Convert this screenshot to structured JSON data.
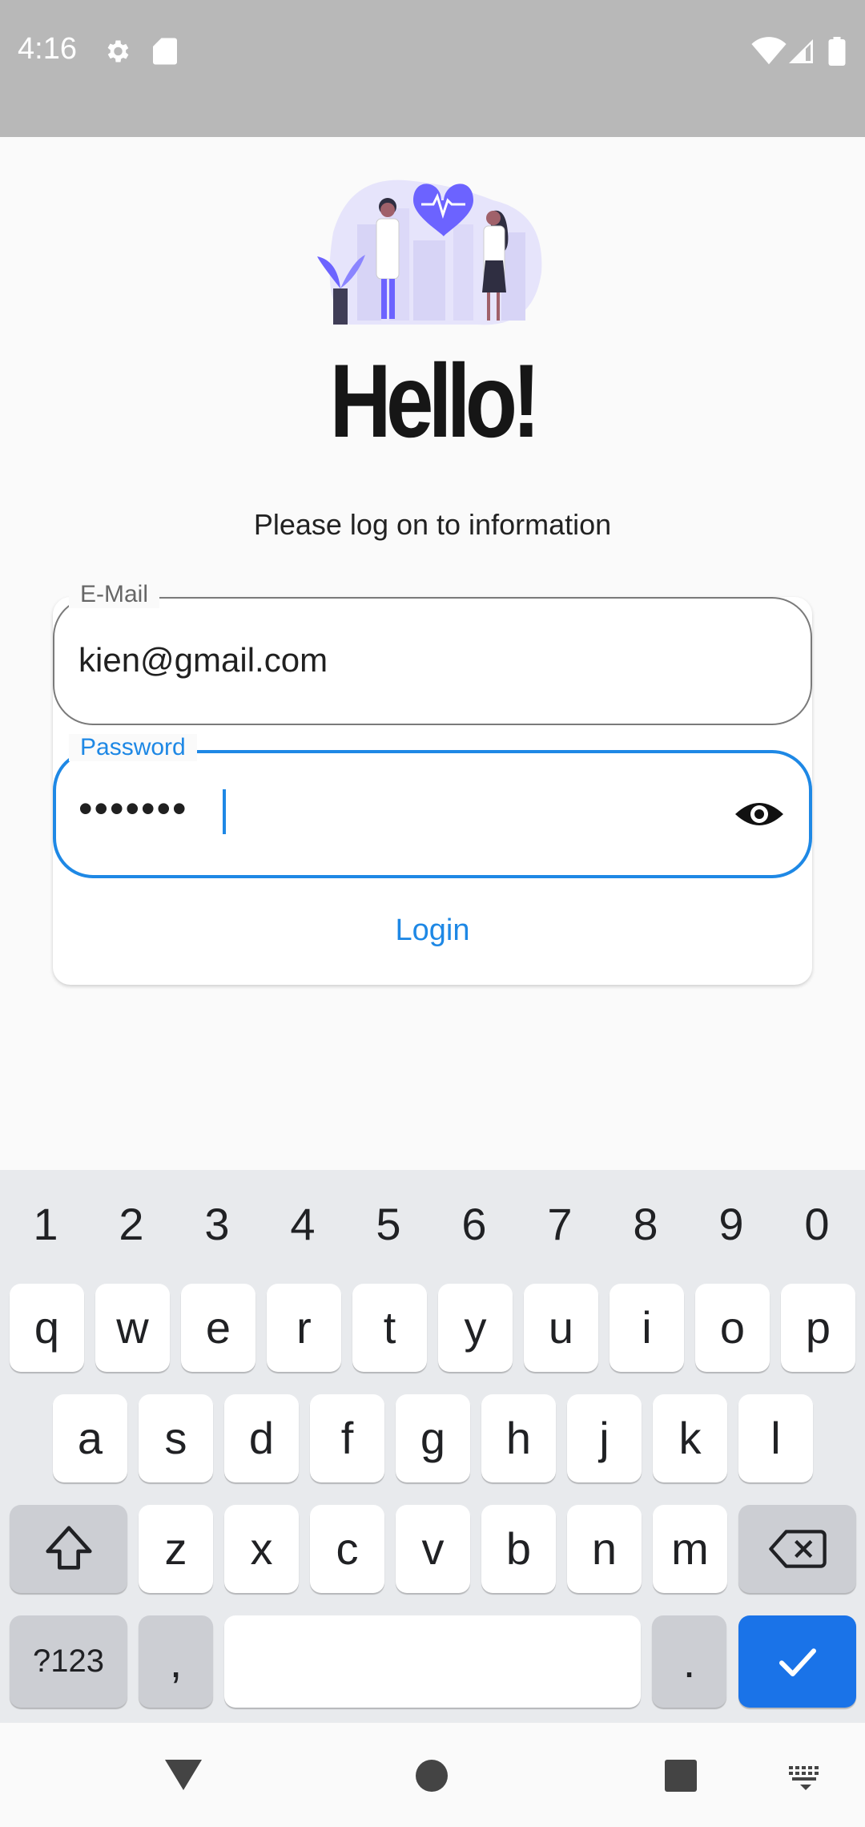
{
  "status_bar": {
    "time": "4:16",
    "icons_left": [
      "gear-icon",
      "sd-card-icon"
    ],
    "icons_right": [
      "wifi-icon",
      "cell-signal-icon",
      "battery-icon"
    ]
  },
  "header": {
    "title": "Hello!",
    "subtitle": "Please log on to information"
  },
  "form": {
    "email": {
      "label": "E-Mail",
      "value": "kien@gmail.com"
    },
    "password": {
      "label": "Password",
      "value": "•••••••",
      "toggle_icon": "eye-icon"
    },
    "login_label": "Login"
  },
  "keyboard": {
    "numbers": [
      "1",
      "2",
      "3",
      "4",
      "5",
      "6",
      "7",
      "8",
      "9",
      "0"
    ],
    "row1": [
      "q",
      "w",
      "e",
      "r",
      "t",
      "y",
      "u",
      "i",
      "o",
      "p"
    ],
    "row2": [
      "a",
      "s",
      "d",
      "f",
      "g",
      "h",
      "j",
      "k",
      "l"
    ],
    "row3": [
      "z",
      "x",
      "c",
      "v",
      "b",
      "n",
      "m"
    ],
    "symbols_label": "?123",
    "comma": ",",
    "period": ".",
    "accent_color": "#1a73e8"
  },
  "nav": {
    "icons": [
      "back-icon",
      "home-icon",
      "recents-icon",
      "keyboard-switch-icon"
    ]
  },
  "colors": {
    "primary": "#1e88e5",
    "status_bar": "#b8b8b8",
    "illustration_purple": "#6c63ff"
  }
}
